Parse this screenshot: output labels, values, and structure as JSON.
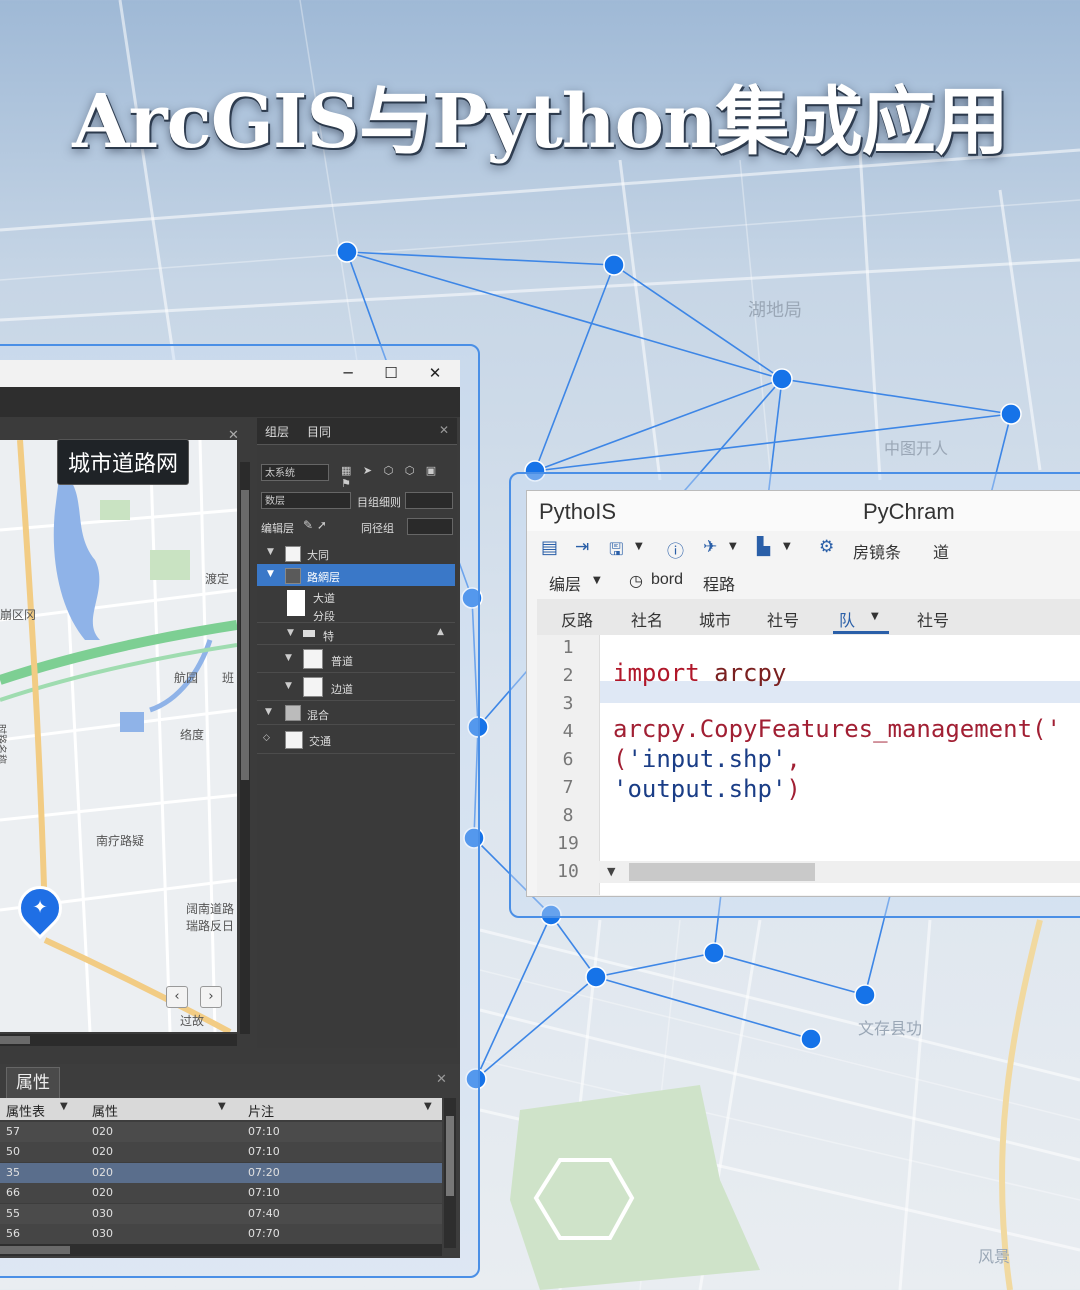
{
  "headline": "ArcGIS与Python集成应用",
  "background_map_labels": [
    "湖地局",
    "中图开人",
    "文存县功",
    "风景"
  ],
  "arcgis": {
    "window_controls": {
      "minimize": "─",
      "maximize": "☐",
      "close": "✕"
    },
    "map_title": "城市道路网",
    "map_labels": [
      "渡定",
      "崩区冈",
      "航园",
      "班",
      "络度",
      "南疗路疑",
      "阔南道路",
      "瑞路反日",
      "过故",
      "时路名称"
    ],
    "map_nav": {
      "prev": "‹",
      "next": "›"
    },
    "toc": {
      "tabs": [
        "组层",
        "目同"
      ],
      "close": "✕",
      "dropdowns": [
        "太系统",
        "数层",
        "目组细则",
        "同径组"
      ],
      "labels": [
        "编辑层"
      ],
      "tree": [
        {
          "label": "大同",
          "checked": true,
          "selected": false
        },
        {
          "label": "路網层",
          "checked": false,
          "selected": true
        },
        {
          "label": "大道",
          "checked": true,
          "selected": false
        },
        {
          "label": "分段",
          "checked": false,
          "selected": false
        },
        {
          "label": "特",
          "checked": false,
          "selected": false
        },
        {
          "label": "普道",
          "checked": true,
          "selected": false
        },
        {
          "label": "边道",
          "checked": true,
          "selected": false
        },
        {
          "label": "混合",
          "checked": false,
          "selected": false
        },
        {
          "label": "交通",
          "checked": true,
          "selected": false
        }
      ]
    },
    "attributes": {
      "tab_label": "属性",
      "close": "✕",
      "columns": [
        "属性表",
        "属性",
        "片注"
      ],
      "rows": [
        [
          "57",
          "020",
          "07:10"
        ],
        [
          "50",
          "020",
          "07:10"
        ],
        [
          "35",
          "020",
          "07:20"
        ],
        [
          "66",
          "020",
          "07:10"
        ],
        [
          "55",
          "030",
          "07:40"
        ],
        [
          "56",
          "030",
          "07:70"
        ]
      ],
      "selected_row": 2
    }
  },
  "pycharm": {
    "left_title": "PythoIS",
    "right_title": "PyChram",
    "toolbar": {
      "label_a": "房镜条",
      "label_b": "道",
      "menu_a": "编层",
      "menu_b": "bord",
      "menu_c": "程路"
    },
    "tabs": [
      "反路",
      "社名",
      "城市",
      "社号",
      "队",
      "社号"
    ],
    "active_tab": 4,
    "line_numbers": [
      "1",
      "2",
      "3",
      "4",
      "6",
      "7",
      "8",
      "19",
      "10"
    ],
    "code": {
      "line2_kw": "import",
      "line2_mod": "arcpy",
      "line4": "arcpy.CopyFeatures_management('",
      "line6_open": "(",
      "line6_str": "'input.shp'",
      "line6_end": ",",
      "line7_str": "'output.shp'",
      "line7_end": ")"
    }
  },
  "colors": {
    "network_line": "#3d86e6",
    "network_node": "#1673e8",
    "frame_border": "#4a8fe6",
    "selection": "#3a78c8"
  }
}
